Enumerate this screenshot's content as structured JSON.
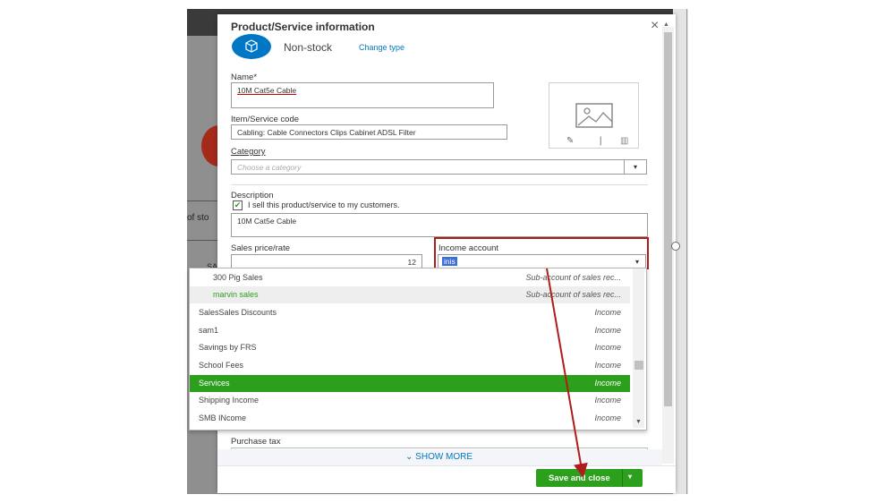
{
  "background": {
    "side_text_1": "of sto",
    "side_text_2": "SA"
  },
  "panel": {
    "title": "Product/Service information",
    "close_glyph": "×"
  },
  "type": {
    "label": "Non-stock",
    "change_link": "Change type",
    "icon": "box-icon"
  },
  "form": {
    "name_label": "Name*",
    "name_value": "10M Cat5e Cable",
    "code_label": "Item/Service code",
    "code_value": "Cabling: Cable Connectors Clips Cabinet ADSL Filter",
    "category_label": "Category",
    "category_placeholder": "Choose a category",
    "description_label": "Description",
    "sell_checkbox_label": "I sell this product/service to my customers.",
    "sell_checked": true,
    "description_value": "10M Cat5e Cable",
    "price_label": "Sales price/rate",
    "price_value": "12",
    "income_label": "Income account",
    "income_value": "inis",
    "purchase_tax_label": "Purchase tax"
  },
  "image_actions": {
    "edit_icon": "pencil-icon",
    "info_icon": "info-icon",
    "delete_icon": "trash-icon"
  },
  "accounts": [
    {
      "name": "300 Pig Sales",
      "type": "Sub-account of sales rec...",
      "sub": true,
      "state": "normal"
    },
    {
      "name": "marvin sales",
      "type": "Sub-account of sales rec...",
      "sub": true,
      "state": "hover"
    },
    {
      "name": "SalesSales Discounts",
      "type": "Income",
      "sub": false,
      "state": "normal"
    },
    {
      "name": "sam1",
      "type": "Income",
      "sub": false,
      "state": "normal"
    },
    {
      "name": "Savings by FRS",
      "type": "Income",
      "sub": false,
      "state": "normal"
    },
    {
      "name": "School Fees",
      "type": "Income",
      "sub": false,
      "state": "normal"
    },
    {
      "name": "Services",
      "type": "Income",
      "sub": false,
      "state": "selected"
    },
    {
      "name": "Shipping Income",
      "type": "Income",
      "sub": false,
      "state": "normal"
    },
    {
      "name": "SMB INcome",
      "type": "Income",
      "sub": false,
      "state": "normal"
    }
  ],
  "footer": {
    "show_more": "SHOW MORE",
    "save_label": "Save and close",
    "save_caret": "▾"
  },
  "colors": {
    "brand_green": "#2ca01c",
    "brand_blue": "#0077c5",
    "annotation_red": "#b01c1c"
  }
}
